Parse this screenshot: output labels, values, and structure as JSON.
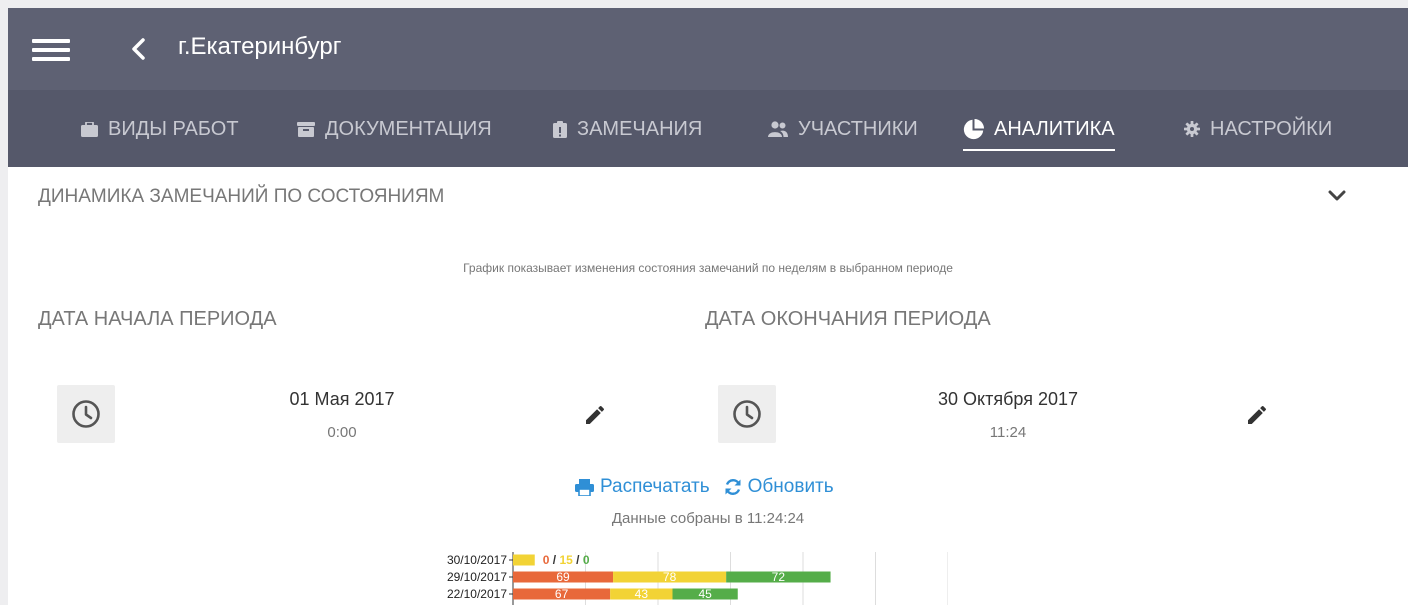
{
  "header": {
    "title": "г.Екатеринбург",
    "menu_icon": "hamburger-icon",
    "back_icon": "chevron-left-icon"
  },
  "tabs": [
    {
      "label": "ВИДЫ РАБОТ",
      "icon": "briefcase-icon",
      "active": false
    },
    {
      "label": "ДОКУМЕНТАЦИЯ",
      "icon": "archive-icon",
      "active": false
    },
    {
      "label": "ЗАМЕЧАНИЯ",
      "icon": "clipboard-icon",
      "active": false
    },
    {
      "label": "УЧАСТНИКИ",
      "icon": "users-icon",
      "active": false
    },
    {
      "label": "АНАЛИТИКА",
      "icon": "pie-chart-icon",
      "active": true
    },
    {
      "label": "НАСТРОЙКИ",
      "icon": "gear-icon",
      "active": false
    }
  ],
  "section": {
    "title": "ДИНАМИКА ЗАМЕЧАНИЙ ПО СОСТОЯНИЯМ",
    "hint": "График показывает изменения состояния замечаний по неделям в выбранном периоде"
  },
  "period": {
    "start": {
      "label": "ДАТА НАЧАЛА ПЕРИОДА",
      "date": "01 Мая 2017",
      "time": "0:00"
    },
    "end": {
      "label": "ДАТА ОКОНЧАНИЯ ПЕРИОДА",
      "date": "30 Октября 2017",
      "time": "11:24"
    }
  },
  "actions": {
    "print_label": "Распечатать",
    "refresh_label": "Обновить"
  },
  "collected_text": "Данные собраны в 11:24:24",
  "colors": {
    "topbar": "#5e6173",
    "tabbar": "#55586a",
    "link": "#2f8fd6",
    "red": "#e8683a",
    "yellow": "#f2d335",
    "green": "#55ad49"
  },
  "chart_data": {
    "type": "bar",
    "orientation": "horizontal",
    "stacked": true,
    "categories": [
      "30/10/2017",
      "29/10/2017",
      "22/10/2017"
    ],
    "series": [
      {
        "values": [
          0,
          69,
          67
        ],
        "color": "#e8683a"
      },
      {
        "values": [
          15,
          78,
          43
        ],
        "color": "#f2d335"
      },
      {
        "values": [
          0,
          72,
          45
        ],
        "color": "#55ad49"
      }
    ],
    "xlim": [
      0,
      300
    ],
    "grid": true
  }
}
